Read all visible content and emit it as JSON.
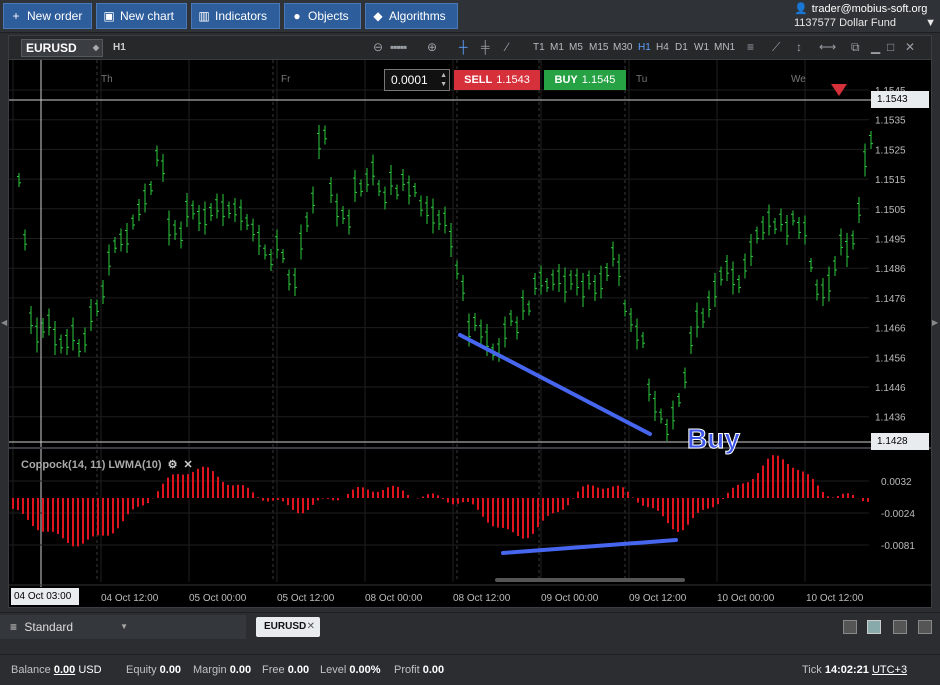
{
  "toolbar": {
    "new_order": "New order",
    "new_chart": "New chart",
    "indicators": "Indicators",
    "objects": "Objects",
    "algorithms": "Algorithms"
  },
  "account": {
    "email": "trader@mobius-soft.org",
    "number": "1137577",
    "fund": "Dollar Fund"
  },
  "chart": {
    "symbol": "EURUSD",
    "timeframe": "H1",
    "timeframes": [
      "T1",
      "M1",
      "M5",
      "M15",
      "M30",
      "H1",
      "H4",
      "D1",
      "W1",
      "MN1"
    ],
    "active_timeframe": "H1",
    "quantity": "0.0001",
    "sell_label": "SELL",
    "sell_price": "1.1543",
    "buy_label": "BUY",
    "buy_price": "1.1545",
    "day_markers": [
      "Th",
      "Fr",
      "Tu",
      "We"
    ],
    "price_ticks": [
      "1.1545",
      "1.1535",
      "1.1525",
      "1.1515",
      "1.1505",
      "1.1495",
      "1.1486",
      "1.1476",
      "1.1466",
      "1.1456",
      "1.1446",
      "1.1436"
    ],
    "crosshair_top_price": "1.1543",
    "crosshair_bottom_price": "1.1428",
    "indicator_label": "Coppock(14, 11) LWMA(10)",
    "indicator_ticks": [
      "0.0032",
      "-0.0024",
      "-0.0081"
    ],
    "time_ticks": [
      "04 Oct 12:00",
      "05 Oct 00:00",
      "05 Oct 12:00",
      "08 Oct 00:00",
      "08 Oct 12:00",
      "09 Oct 00:00",
      "09 Oct 12:00",
      "10 Oct 00:00",
      "10 Oct 12:00"
    ],
    "crosshair_time": "04 Oct 03:00",
    "annotation": "Buy",
    "colors": {
      "bull": "#2ecc40",
      "bear": "#2ecc40",
      "indicator": "#e0141e",
      "trendline": "#4766f0",
      "sell": "#d6303a",
      "buy": "#26a244"
    }
  },
  "workspace": {
    "name": "Standard",
    "tab": "EURUSD"
  },
  "status": {
    "balance_label": "Balance",
    "balance_value": "0.00",
    "balance_currency": "USD",
    "equity_label": "Equity",
    "equity_value": "0.00",
    "margin_label": "Margin",
    "margin_value": "0.00",
    "free_label": "Free",
    "free_value": "0.00",
    "level_label": "Level",
    "level_value": "0.00%",
    "profit_label": "Profit",
    "profit_value": "0.00",
    "tick_label": "Tick",
    "tick_time": "14:02:21",
    "timezone": "UTC+3"
  }
}
